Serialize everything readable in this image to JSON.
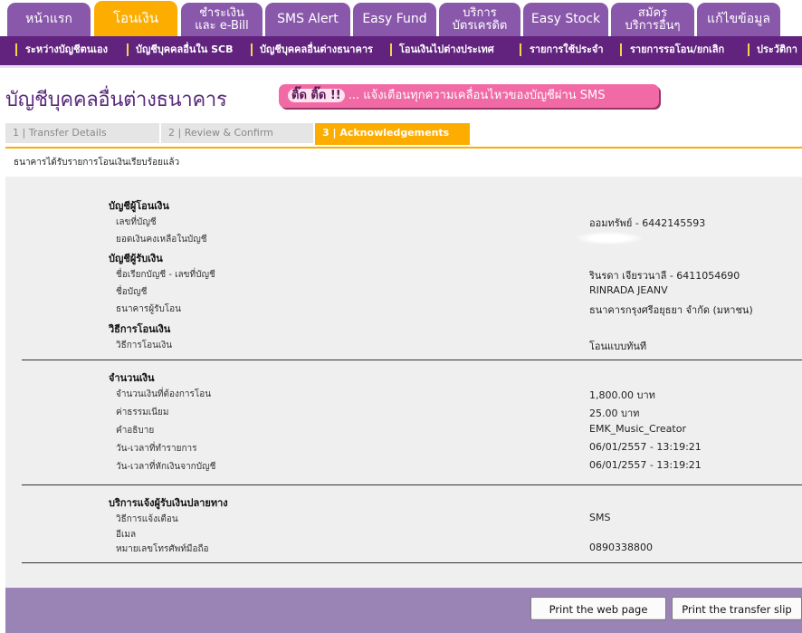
{
  "top_tabs": [
    {
      "label": "หน้าแรก"
    },
    {
      "label": "โอนเงิน"
    },
    {
      "label1": "ชำระเงิน",
      "label2": "และ e-Bill"
    },
    {
      "label": "SMS Alert"
    },
    {
      "label": "Easy Fund"
    },
    {
      "label1": "บริการ",
      "label2": "บัตรเครดิต"
    },
    {
      "label": "Easy Stock"
    },
    {
      "label1": "สมัคร",
      "label2": "บริการอื่นๆ"
    },
    {
      "label": "แก้ไขข้อมูล"
    }
  ],
  "sub_nav": [
    "ระหว่างบัญชีตนเอง",
    "บัญชีบุคคลอื่นใน SCB",
    "บัญชีบุคคลอื่นต่างธนาคาร",
    "โอนเงินไปต่างประเทศ",
    "รายการใช้ประจำ",
    "รายการรอโอน/ยกเลิก",
    "ประวัติกา"
  ],
  "page_title": "บัญชีบุคคลอื่นต่างธนาคาร",
  "sms_banner": {
    "highlight": "ติ๊ด ติ๊ด !!",
    "text": "... แจ้งเตือนทุกความเคลื่อนไหวของบัญชีผ่าน SMS"
  },
  "steps": [
    "1 | Transfer Details",
    "2 | Review & Confirm",
    "3 | Acknowledgements"
  ],
  "confirmation_message": "ธนาคารได้รับรายการโอนเงินเรียบร้อยแล้ว",
  "sender": {
    "heading": "บัญชีผู้โอนเงิน",
    "account_no_label": "เลขที่บัญชี",
    "account_no_value": "ออมทรัพย์ - 6442145593",
    "balance_label": "ยอดเงินคงเหลือในบัญชี"
  },
  "receiver": {
    "heading": "บัญชีผู้รับเงิน",
    "nickname_label": "ชื่อเรียกบัญชี - เลขที่บัญชี",
    "nickname_value": "รินรดา เจียรวนาลี - 6411054690",
    "account_name_label": "ชื่อบัญชี",
    "account_name_value": "RINRADA JEANV",
    "bank_label": "ธนาคารผู้รับโอน",
    "bank_value": "ธนาคารกรุงศรีอยุธยา จำกัด (มหาชน)"
  },
  "method": {
    "heading": "วิธีการโอนเงิน",
    "label": "วิธีการโอนเงิน",
    "value": "โอนแบบทันที"
  },
  "amount": {
    "heading": "จำนวนเงิน",
    "amount_label": "จำนวนเงินที่ต้องการโอน",
    "amount_value": "1,800.00 บาท",
    "fee_label": "ค่าธรรมเนียม",
    "fee_value": "25.00  บาท",
    "desc_label": "คำอธิบาย",
    "desc_value": "EMK_Music_Creator",
    "txn_time_label": "วัน-เวลาที่ทำรายการ",
    "txn_time_value": "06/01/2557 - 13:19:21",
    "debit_time_label": "วัน-เวลาที่หักเงินจากบัญชี",
    "debit_time_value": "06/01/2557 - 13:19:21"
  },
  "notify": {
    "heading": "บริการแจ้งผู้รับเงินปลายทาง",
    "method_label": "วิธีการแจ้งเตือน",
    "method_value": "SMS",
    "email_label": "อีเมล",
    "phone_label": "หมายเลขโทรศัพท์มือถือ",
    "phone_value": "0890338800"
  },
  "buttons": {
    "print_page": "Print the web page",
    "print_slip": "Print the transfer slip"
  },
  "colors": {
    "purple_tab": "#8a58ab",
    "active_tab": "#fcad00",
    "subnav": "#62237f",
    "footer": "#9a83b5",
    "banner": "#f26aa5"
  }
}
